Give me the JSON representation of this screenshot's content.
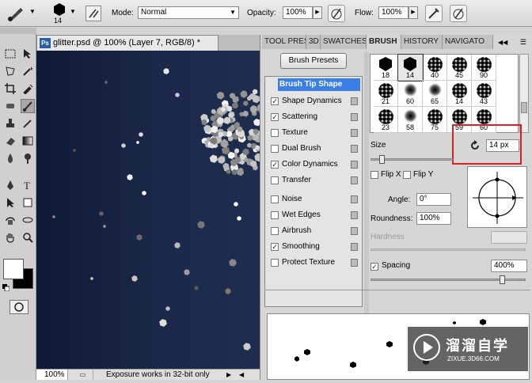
{
  "options_bar": {
    "brush_size": "14",
    "mode_label": "Mode:",
    "mode_value": "Normal",
    "opacity_label": "Opacity:",
    "opacity_value": "100%",
    "flow_label": "Flow:",
    "flow_value": "100%"
  },
  "document": {
    "tab_title": "glitter.psd @ 100% (Layer 7, RGB/8) *",
    "zoom": "100%",
    "status": "Exposure works in 32-bit only"
  },
  "panel": {
    "tabs": [
      "TOOL PRES",
      "3D",
      "SWATCHES",
      "BRUSH",
      "HISTORY",
      "NAVIGATO"
    ],
    "active_tab": "BRUSH",
    "brush_presets_button": "Brush Presets",
    "brush_tip_shape": "Brush Tip Shape",
    "options": [
      {
        "label": "Shape Dynamics",
        "checked": "✓"
      },
      {
        "label": "Scattering",
        "checked": "✓"
      },
      {
        "label": "Texture",
        "checked": ""
      },
      {
        "label": "Dual Brush",
        "checked": ""
      },
      {
        "label": "Color Dynamics",
        "checked": "✓"
      },
      {
        "label": "Transfer",
        "checked": ""
      },
      {
        "label": "Noise",
        "checked": ""
      },
      {
        "label": "Wet Edges",
        "checked": ""
      },
      {
        "label": "Airbrush",
        "checked": ""
      },
      {
        "label": "Smoothing",
        "checked": "✓"
      },
      {
        "label": "Protect Texture",
        "checked": ""
      }
    ],
    "thumbnail_sizes": [
      "18",
      "14",
      "40",
      "45",
      "90",
      "21",
      "60",
      "65",
      "14",
      "43",
      "23",
      "58",
      "75",
      "59",
      "60"
    ],
    "size_label": "Size",
    "size_value": "14 px",
    "flip_x": "Flip X",
    "flip_y": "Flip Y",
    "angle_label": "Angle:",
    "angle_value": "0°",
    "roundness_label": "Roundness:",
    "roundness_value": "100%",
    "hardness_label": "Hardness",
    "spacing_label": "Spacing",
    "spacing_value": "400%",
    "highlight_color": "#e02020"
  },
  "watermark": {
    "cn_text": "溜溜自学",
    "url": "ZIXUE.3D66.COM"
  }
}
